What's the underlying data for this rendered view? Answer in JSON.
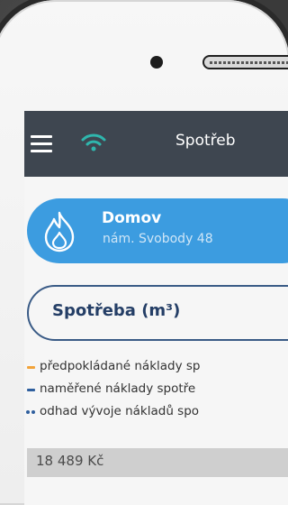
{
  "app": {
    "title": "Spotřeb"
  },
  "location": {
    "name": "Domov",
    "address": "nám. Svobody 48"
  },
  "consumption_button": {
    "label": "Spotřeba (m³)"
  },
  "legend": [
    {
      "text": "předpokládané náklady sp",
      "color": "#f2a33a",
      "style": "dash"
    },
    {
      "text": "naměřené náklady spotře",
      "color": "#2f5f9e",
      "style": "dash"
    },
    {
      "text": "odhad vývoje nákladů spo",
      "color": "#2f5f9e",
      "style": "dots"
    }
  ],
  "chart": {
    "top_value": "18 489 Kč"
  },
  "colors": {
    "appbar": "#3e4650",
    "accent_blue": "#3c9ce0",
    "button_border": "#3a5b86",
    "wifi": "#2fb6ad"
  },
  "icons": [
    "menu-icon",
    "wifi-icon",
    "flame-icon"
  ]
}
